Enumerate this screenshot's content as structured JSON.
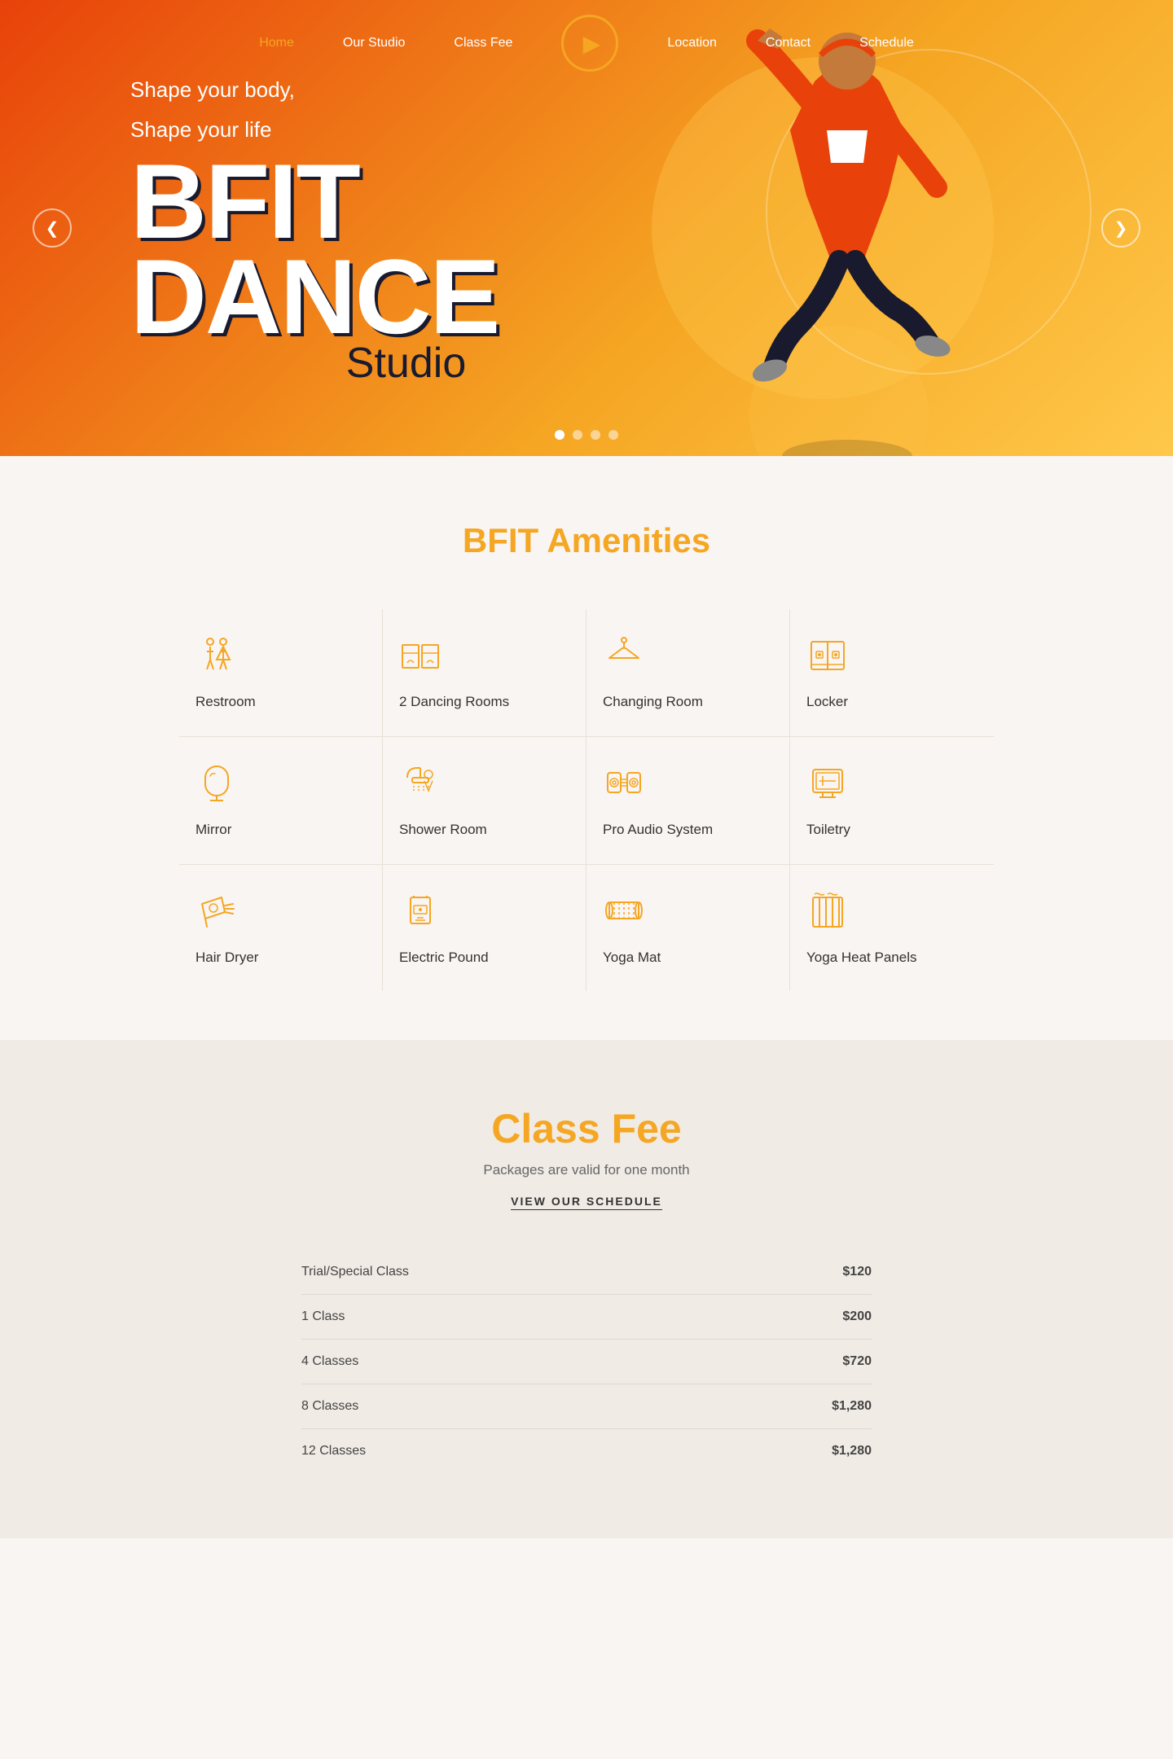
{
  "nav": {
    "links": [
      {
        "label": "Home",
        "active": true
      },
      {
        "label": "Our Studio",
        "active": false
      },
      {
        "label": "Class Fee",
        "active": false
      },
      {
        "label": "Location",
        "active": false
      },
      {
        "label": "Contact",
        "active": false
      },
      {
        "label": "Schedule",
        "active": false
      }
    ]
  },
  "hero": {
    "tagline_line1": "Shape your body,",
    "tagline_line2": "Shape your life",
    "title_bfit": "BFIT",
    "title_dance": "DANCE",
    "title_studio": "Studio",
    "prev_btn": "❮",
    "next_btn": "❯"
  },
  "amenities": {
    "section_label": "BFIT",
    "section_title": "Amenities",
    "items": [
      {
        "label": "Restroom",
        "icon": "restroom"
      },
      {
        "label": "2 Dancing Rooms",
        "icon": "dancing-rooms"
      },
      {
        "label": "Changing Room",
        "icon": "changing-room"
      },
      {
        "label": "Locker",
        "icon": "locker"
      },
      {
        "label": "Mirror",
        "icon": "mirror"
      },
      {
        "label": "Shower Room",
        "icon": "shower-room"
      },
      {
        "label": "Pro Audio System",
        "icon": "audio-system"
      },
      {
        "label": "Toiletry",
        "icon": "toiletry"
      },
      {
        "label": "Hair Dryer",
        "icon": "hair-dryer"
      },
      {
        "label": "Electric Pound",
        "icon": "electric-pound"
      },
      {
        "label": "Yoga Mat",
        "icon": "yoga-mat"
      },
      {
        "label": "Yoga Heat Panels",
        "icon": "yoga-heat-panels"
      }
    ]
  },
  "class_fee": {
    "label": "Class",
    "title_accent": "Fee",
    "subtitle": "Packages are valid for one month",
    "schedule_link": "VIEW OUR SCHEDULE",
    "packages": [
      {
        "name": "Trial/Special Class",
        "price": "$120"
      },
      {
        "name": "1 Class",
        "price": "$200"
      },
      {
        "name": "4 Classes",
        "price": "$720"
      },
      {
        "name": "8 Classes",
        "price": "$1,280"
      },
      {
        "name": "12 Classes",
        "price": "$1,280"
      }
    ]
  },
  "colors": {
    "orange": "#f5a623",
    "dark": "#1a1a2e",
    "hero_grad_start": "#e8420a",
    "hero_grad_end": "#ffc84a"
  }
}
